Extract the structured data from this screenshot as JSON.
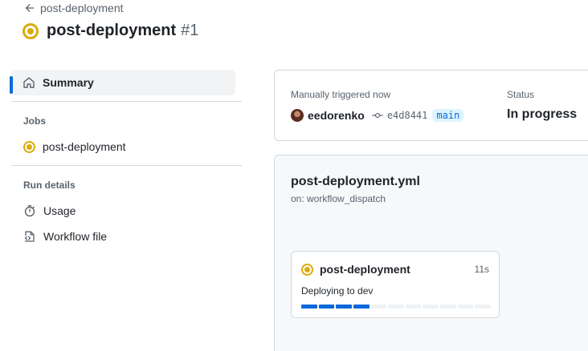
{
  "header": {
    "back_label": "post-deployment",
    "title": "post-deployment",
    "run_number": "#1"
  },
  "sidebar": {
    "summary_label": "Summary",
    "jobs_heading": "Jobs",
    "jobs": [
      {
        "label": "post-deployment",
        "status": "in-progress"
      }
    ],
    "run_details_heading": "Run details",
    "run_details": [
      {
        "label": "Usage",
        "icon": "stopwatch-icon"
      },
      {
        "label": "Workflow file",
        "icon": "file-code-icon"
      }
    ]
  },
  "summary": {
    "trigger_text": "Manually triggered now",
    "actor": "eedorenko",
    "commit_sha": "e4d8441",
    "branch": "main",
    "status_label": "Status",
    "status_value": "In progress"
  },
  "workflow": {
    "file_name": "post-deployment.yml",
    "trigger": "on: workflow_dispatch",
    "job": {
      "name": "post-deployment",
      "duration": "11s",
      "current_step": "Deploying to dev",
      "progress_segments_total": 11,
      "progress_segments_done": 4
    }
  },
  "colors": {
    "accent": "#0969da",
    "in_progress": "#dbab09",
    "border": "#d1d9e0"
  }
}
